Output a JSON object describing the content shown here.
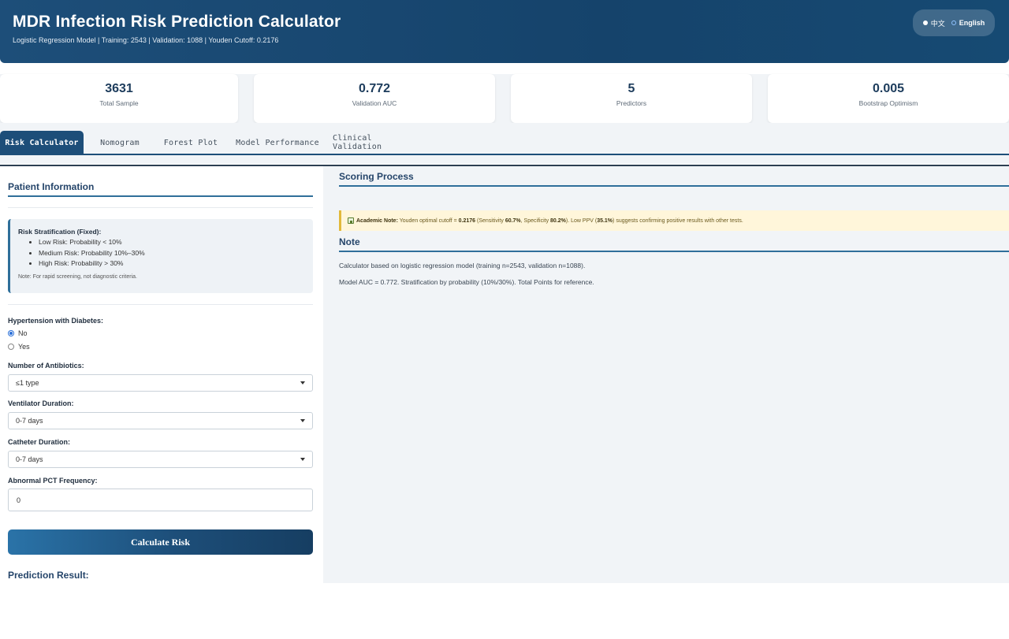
{
  "header": {
    "title": "MDR Infection Risk Prediction Calculator",
    "subtitle": "Logistic Regression Model | Training: 2543 | Validation: 1088 | Youden Cutoff: 0.2176",
    "lang": {
      "zh": "中文",
      "en": "English"
    }
  },
  "stats": [
    {
      "value": "3631",
      "label": "Total Sample"
    },
    {
      "value": "0.772",
      "label": "Validation AUC"
    },
    {
      "value": "5",
      "label": "Predictors"
    },
    {
      "value": "0.005",
      "label": "Bootstrap Optimism"
    }
  ],
  "tabs": [
    "Risk Calculator",
    "Nomogram",
    "Forest Plot",
    "Model Performance",
    "Clinical Validation"
  ],
  "left": {
    "section_title": "Patient Information",
    "risk_box": {
      "title": "Risk Stratification (Fixed):",
      "items": [
        "Low Risk: Probability < 10%",
        "Medium Risk: Probability 10%–30%",
        "High Risk: Probability > 30%"
      ],
      "note": "Note: For rapid screening, not diagnostic criteria."
    },
    "hypertension": {
      "label": "Hypertension with Diabetes:",
      "no": "No",
      "yes": "Yes"
    },
    "antibiotics": {
      "label": "Number of Antibiotics:",
      "value": "≤1 type"
    },
    "ventilator": {
      "label": "Ventilator Duration:",
      "value": "0-7 days"
    },
    "catheter": {
      "label": "Catheter Duration:",
      "value": "0-7 days"
    },
    "pct": {
      "label": "Abnormal PCT Frequency:",
      "value": "0"
    },
    "calc_button": "Calculate Risk",
    "prediction_title": "Prediction Result:"
  },
  "right": {
    "scoring_title": "Scoring Process",
    "academic_note": {
      "label": "Academic Note:",
      "t1": " Youden optimal cutoff = ",
      "cutoff": "0.2176",
      "t2": " (Sensitivity ",
      "sens": "60.7%",
      "t3": ", Specificity ",
      "spec": "80.2%",
      "t4": "). Low PPV (",
      "ppv": "35.1%",
      "t5": ") suggests confirming positive results with other tests."
    },
    "note_title": "Note",
    "note_line1": "Calculator based on logistic regression model (training n=2543, validation n=1088).",
    "note_line2": "Model AUC = 0.772. Stratification by probability (10%/30%). Total Points for reference."
  }
}
